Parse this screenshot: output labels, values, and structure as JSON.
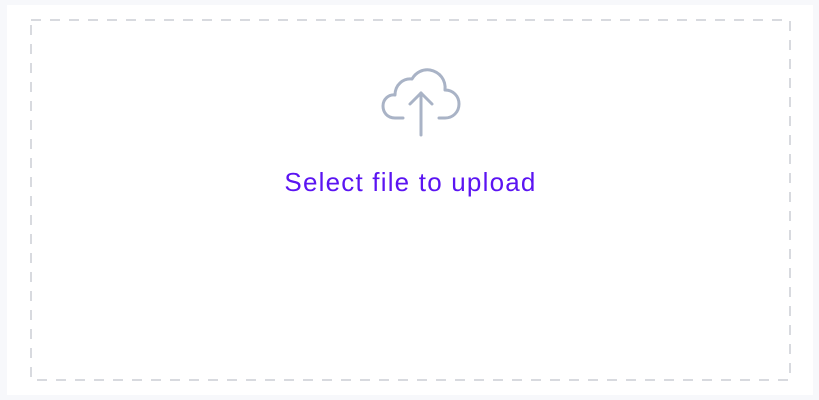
{
  "upload": {
    "label": "Select file to upload",
    "icon": "cloud-upload-icon"
  },
  "colors": {
    "accent": "#5b14f2",
    "icon_stroke": "#a9b3c6",
    "dash_border": "#d8dadf",
    "background": "#f7f8fb",
    "panel": "#ffffff"
  }
}
